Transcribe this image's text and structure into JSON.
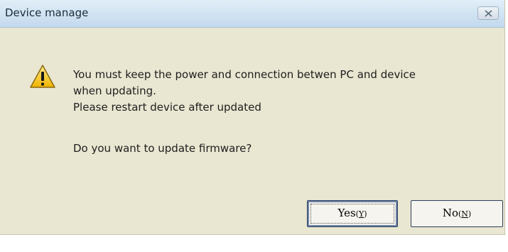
{
  "window": {
    "title": "Device manage"
  },
  "message": {
    "line1": "You must keep the power and connection betwen PC and device",
    "line2": "when updating.",
    "line3": "Please restart device after updated",
    "question": "Do you want to update firmware?"
  },
  "icons": {
    "warning": "warning-icon",
    "close": "close-icon"
  },
  "buttons": {
    "yes": {
      "label": "Yes",
      "paren_open": "(",
      "mnemonic": "Y",
      "paren_close": ")"
    },
    "no": {
      "label": "No",
      "paren_open": "(",
      "mnemonic": "N",
      "paren_close": ")"
    }
  }
}
